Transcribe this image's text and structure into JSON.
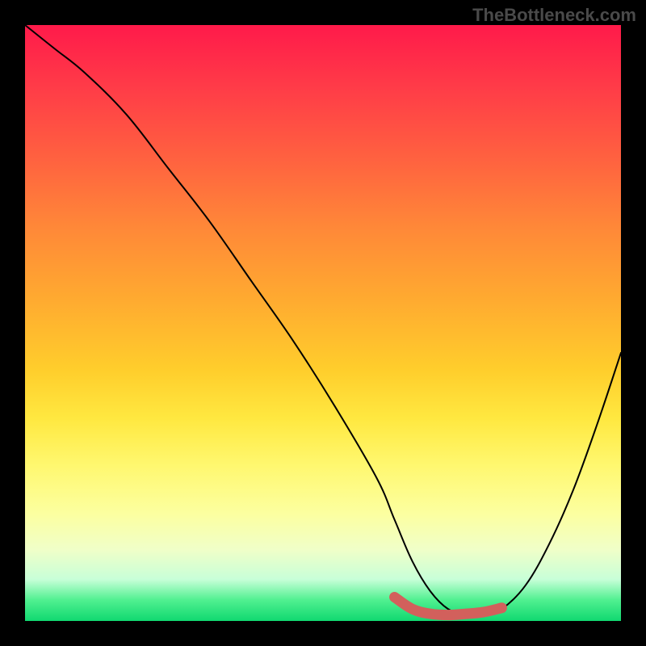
{
  "watermark": "TheBottleneck.com",
  "chart_data": {
    "type": "line",
    "title": "",
    "xlabel": "",
    "ylabel": "",
    "xlim": [
      0,
      100
    ],
    "ylim": [
      0,
      100
    ],
    "series": [
      {
        "name": "bottleneck-curve",
        "x": [
          0,
          5,
          10,
          17,
          24,
          31,
          38,
          45,
          52,
          59,
          62,
          65,
          68,
          71,
          74,
          77,
          80,
          84,
          88,
          92,
          96,
          100
        ],
        "y": [
          100,
          96,
          92,
          85,
          76,
          67,
          57,
          47,
          36,
          24,
          17,
          10,
          5,
          2,
          1,
          1,
          2,
          6,
          13,
          22,
          33,
          45
        ]
      }
    ],
    "highlight": {
      "name": "bottleneck-zone",
      "x": [
        62,
        65,
        68,
        71,
        74,
        77,
        80
      ],
      "y": [
        4,
        2,
        1.2,
        1,
        1.2,
        1.5,
        2.2
      ]
    },
    "background": "green-yellow-red-gradient"
  }
}
